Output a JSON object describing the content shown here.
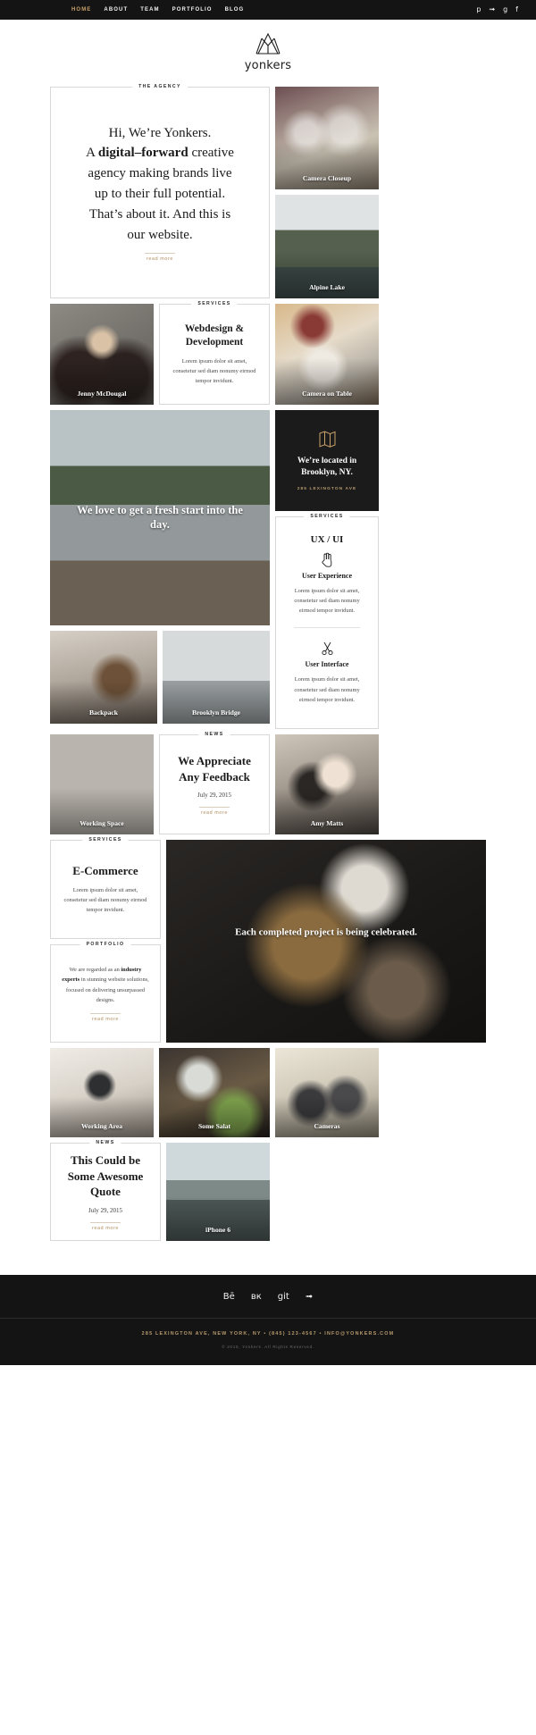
{
  "nav": {
    "links": [
      {
        "label": "HOME",
        "active": true
      },
      {
        "label": "ABOUT",
        "active": false
      },
      {
        "label": "TEAM",
        "active": false
      },
      {
        "label": "PORTFOLIO",
        "active": false
      },
      {
        "label": "BLOG",
        "active": false
      }
    ],
    "social": [
      {
        "name": "pinterest-icon",
        "glyph": "p"
      },
      {
        "name": "twitter-icon",
        "glyph": "ᵛ"
      },
      {
        "name": "googleplus-icon",
        "glyph": "g"
      },
      {
        "name": "facebook-icon",
        "glyph": "f"
      }
    ]
  },
  "brand": {
    "name": "yonkers"
  },
  "accent_color": "#c9a06a",
  "hero": {
    "ribbon": "THE AGENCY",
    "line1": "Hi, We’re Yonkers.",
    "line2_a": "A ",
    "line2_b": "digital–forward",
    "line2_c": " creative",
    "line3": "agency making brands live",
    "line4": "up to their full potential.",
    "line5": "That’s about it. And this is",
    "line6": "our website.",
    "read_more": "read more"
  },
  "tiles": {
    "camera_closeup": "Camera Closeup",
    "alpine_lake": "Alpine Lake",
    "jenny": "Jenny McDougal",
    "camera_on_table": "Camera on Table",
    "bike": "We love to get a fresh start into the day.",
    "backpack": "Backpack",
    "brooklyn_bridge": "Brooklyn Bridge",
    "working_space": "Working Space",
    "amy": "Amy Matts",
    "project": "Each completed project is being celebrated.",
    "working_area": "Working Area",
    "some_salat": "Some Salat",
    "cameras": "Cameras",
    "iphone": "iPhone 6"
  },
  "webdesign": {
    "ribbon": "SERVICES",
    "title": "Webdesign & Development",
    "body": "Lorem ipsum dolor sit amet, consetetur sed diam nonumy eirmod tempor invidunt."
  },
  "location": {
    "icon": "map-pin-icon",
    "line1": "We’re located in",
    "line2": "Brooklyn, NY.",
    "address": "285 LEXINGTON AVE"
  },
  "uxui": {
    "ribbon": "SERVICES",
    "title": "UX / UI",
    "items": [
      {
        "icon": "hand-gesture-icon",
        "name": "User Experience",
        "body": "Lorem ipsum dolor sit amet, consetetur sed diam nonumy eirmod tempor invidunt."
      },
      {
        "icon": "scissors-icon",
        "name": "User Interface",
        "body": "Lorem ipsum dolor sit amet, consetetur sed diam nonumy eirmod tempor invidunt."
      }
    ]
  },
  "news_feedback": {
    "ribbon": "NEWS",
    "title": "We Appreciate Any Feedback",
    "date": "July 29, 2015",
    "read_more": "read more"
  },
  "ecommerce": {
    "ribbon": "SERVICES",
    "title": "E-Commerce",
    "body": "Lorem ipsum dolor sit amet, consetetur sed diam nonumy eirmod tempor invidunt."
  },
  "portfolio_card": {
    "ribbon": "PORTFOLIO",
    "body_a": "We are regarded as an ",
    "body_b": "industry experts",
    "body_c": " in stunning website solutions, focused on delivering unsurpassed designs.",
    "read_more": "read more"
  },
  "news_quote": {
    "ribbon": "NEWS",
    "title": "This Could be Some Awesome Quote",
    "date": "July 29, 2015",
    "read_more": "read more"
  },
  "footer": {
    "social": [
      {
        "name": "behance-icon",
        "glyph": "Bē"
      },
      {
        "name": "vk-icon",
        "glyph": "вк"
      },
      {
        "name": "git-icon",
        "glyph": "git"
      },
      {
        "name": "twitter-icon",
        "glyph": "ᵛ"
      }
    ],
    "address": "285 LEXINGTON AVE, NEW YORK, NY  •  (845) 123-4567  •  INFO@YONKERS.COM",
    "copyright": "© 2015, Yonkers. All Rights Reserved."
  }
}
